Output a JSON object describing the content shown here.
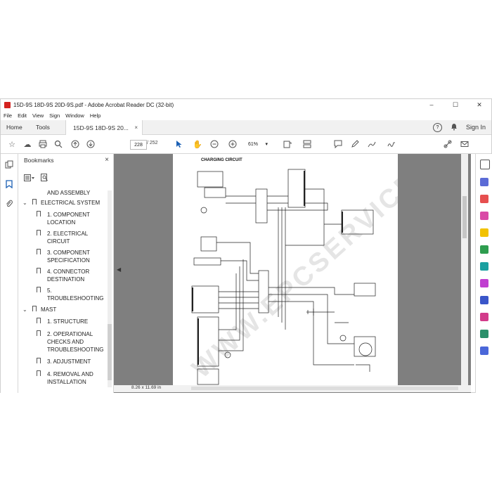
{
  "window": {
    "title": "15D-9S 18D-9S 20D-9S.pdf - Adobe Acrobat Reader DC (32-bit)",
    "controls": [
      "–",
      "☐",
      "✕"
    ]
  },
  "menubar": [
    "File",
    "Edit",
    "View",
    "Sign",
    "Window",
    "Help"
  ],
  "tabs": {
    "home": "Home",
    "tools": "Tools",
    "document": "15D-9S 18D-9S 20...",
    "document_close": "×",
    "help_icon": "?",
    "signin": "Sign In"
  },
  "toolbar": {
    "current_page": "228",
    "total_pages": "/ 252",
    "zoom": "61%",
    "zoom_caret": "▾"
  },
  "bookmarks": {
    "header": "Bookmarks",
    "close": "×",
    "items": [
      {
        "label": "AND ASSEMBLY",
        "level": 1
      },
      {
        "label": "ELECTRICAL SYSTEM",
        "level": 0
      },
      {
        "label": "1. COMPONENT LOCATION",
        "level": 1
      },
      {
        "label": "2. ELECTRICAL CIRCUIT",
        "level": 1
      },
      {
        "label": "3. COMPONENT SPECIFICATION",
        "level": 1
      },
      {
        "label": "4. CONNECTOR DESTINATION",
        "level": 1
      },
      {
        "label": "5. TROUBLESHOOTING",
        "level": 1
      },
      {
        "label": "MAST",
        "level": 0
      },
      {
        "label": "1. STRUCTURE",
        "level": 1
      },
      {
        "label": "2. OPERATIONAL CHECKS AND TROUBLESHOOTING",
        "level": 1
      },
      {
        "label": "3. ADJUSTMENT",
        "level": 1
      },
      {
        "label": "4. REMOVAL AND INSTALLATION",
        "level": 1
      }
    ]
  },
  "document": {
    "page_title": "CHARGING CIRCUIT",
    "watermark": "WWW.EPCSERVICE.COM",
    "page_size": "8.26 x 11.69 in"
  }
}
